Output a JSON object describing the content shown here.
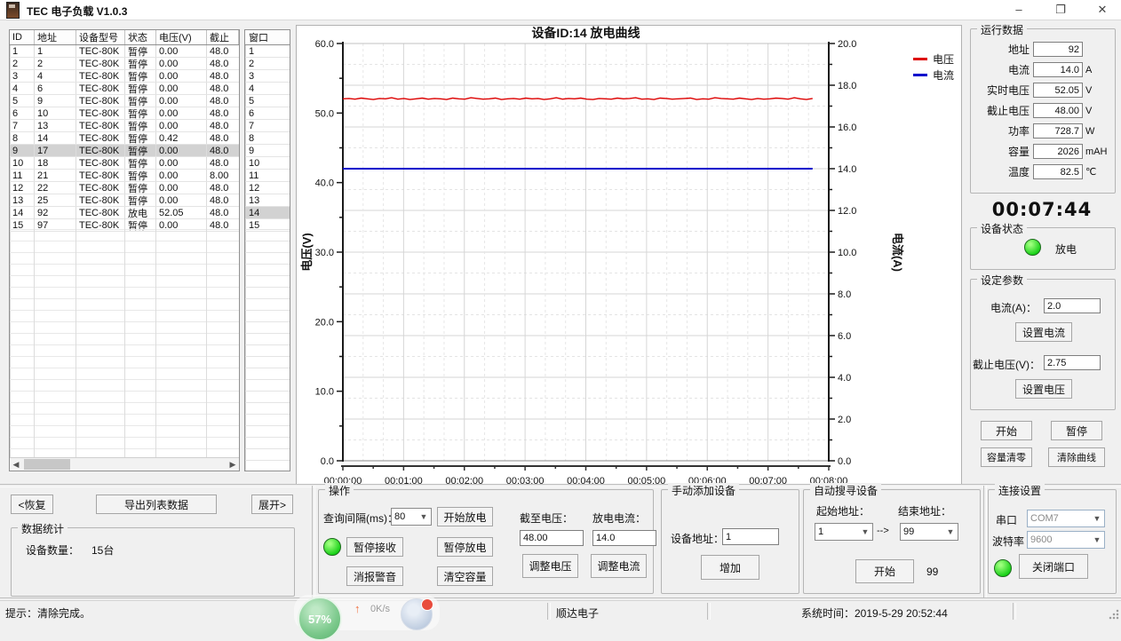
{
  "window": {
    "title": "TEC 电子负载 V1.0.3",
    "minimize": "–",
    "maximize": "❐",
    "close": "✕"
  },
  "left_table": {
    "headers": [
      "ID",
      "地址",
      "设备型号",
      "状态",
      "电压(V)",
      "截止"
    ],
    "selected_index": 8,
    "rows": [
      [
        "1",
        "1",
        "TEC-80K",
        "暂停",
        "0.00",
        "48.0"
      ],
      [
        "2",
        "2",
        "TEC-80K",
        "暂停",
        "0.00",
        "48.0"
      ],
      [
        "3",
        "4",
        "TEC-80K",
        "暂停",
        "0.00",
        "48.0"
      ],
      [
        "4",
        "6",
        "TEC-80K",
        "暂停",
        "0.00",
        "48.0"
      ],
      [
        "5",
        "9",
        "TEC-80K",
        "暂停",
        "0.00",
        "48.0"
      ],
      [
        "6",
        "10",
        "TEC-80K",
        "暂停",
        "0.00",
        "48.0"
      ],
      [
        "7",
        "13",
        "TEC-80K",
        "暂停",
        "0.00",
        "48.0"
      ],
      [
        "8",
        "14",
        "TEC-80K",
        "暂停",
        "0.42",
        "48.0"
      ],
      [
        "9",
        "17",
        "TEC-80K",
        "暂停",
        "0.00",
        "48.0"
      ],
      [
        "10",
        "18",
        "TEC-80K",
        "暂停",
        "0.00",
        "48.0"
      ],
      [
        "11",
        "21",
        "TEC-80K",
        "暂停",
        "0.00",
        "8.00"
      ],
      [
        "12",
        "22",
        "TEC-80K",
        "暂停",
        "0.00",
        "48.0"
      ],
      [
        "13",
        "25",
        "TEC-80K",
        "暂停",
        "0.00",
        "48.0"
      ],
      [
        "14",
        "92",
        "TEC-80K",
        "放电",
        "52.05",
        "48.0"
      ],
      [
        "15",
        "97",
        "TEC-80K",
        "暂停",
        "0.00",
        "48.0"
      ]
    ]
  },
  "window_table": {
    "header": "窗口",
    "selected_index": 13,
    "rows": [
      "1",
      "2",
      "3",
      "4",
      "5",
      "6",
      "7",
      "8",
      "9",
      "10",
      "11",
      "12",
      "13",
      "14",
      "15"
    ]
  },
  "chart": {
    "type": "line",
    "title": "设备ID:14 放电曲线",
    "legend": [
      {
        "name": "电压",
        "color": "#dd0000"
      },
      {
        "name": "电流",
        "color": "#0000cc"
      }
    ],
    "y_left": {
      "label": "电压(V)",
      "min": 0,
      "max": 60,
      "major_step": 10,
      "minor_step": 5
    },
    "y_right": {
      "label": "电流(A)",
      "min": 0,
      "max": 20,
      "major_step": 2,
      "minor_step": 1
    },
    "x": {
      "labels": [
        "00:00:00",
        "00:01:00",
        "00:02:00",
        "00:03:00",
        "00:04:00",
        "00:05:00",
        "00:06:00",
        "00:07:00",
        "00:08:00"
      ],
      "max_seconds": 480,
      "data_end_seconds": 464
    },
    "series": [
      {
        "name": "电压",
        "axis": "left",
        "color": "#dd0000",
        "values": [
          52.05,
          52.1,
          52.0,
          52.15,
          52.05,
          51.95,
          52.1,
          52.05,
          52.2,
          52.0,
          52.1,
          51.95,
          52.05,
          52.15,
          52.0,
          52.1,
          52.05,
          51.95,
          52.15,
          52.05,
          52.0,
          52.2,
          52.1,
          52.0,
          52.05,
          52.15,
          51.95,
          52.05,
          52.1,
          52.0,
          52.15,
          52.05,
          52.1,
          51.95,
          52.05,
          52.2,
          52.0,
          52.1,
          52.05,
          52.15,
          52.0,
          51.95,
          52.1,
          52.05,
          52.0,
          52.15,
          52.05,
          52.1,
          52.2,
          52.0,
          52.05,
          51.95,
          52.15,
          52.1,
          52.0,
          52.05,
          52.1,
          52.15,
          51.95,
          52.05,
          52.0,
          52.2,
          52.1,
          52.05,
          52.0,
          52.15,
          52.05,
          51.95,
          52.1,
          52.0,
          52.05,
          52.15,
          52.1,
          52.0,
          52.2,
          52.05,
          51.95,
          52.1
        ]
      },
      {
        "name": "电流",
        "axis": "right",
        "color": "#0000cc",
        "constant": 14.0
      }
    ]
  },
  "run_data": {
    "title": "运行数据",
    "fields": [
      {
        "label": "地址",
        "value": "92",
        "unit": ""
      },
      {
        "label": "电流",
        "value": "14.0",
        "unit": "A"
      },
      {
        "label": "实时电压",
        "value": "52.05",
        "unit": "V"
      },
      {
        "label": "截止电压",
        "value": "48.00",
        "unit": "V"
      },
      {
        "label": "功率",
        "value": "728.7",
        "unit": "W"
      },
      {
        "label": "容量",
        "value": "2026",
        "unit": "mAH"
      },
      {
        "label": "温度",
        "value": "82.5",
        "unit": "℃"
      }
    ]
  },
  "timer": "00:07:44",
  "device_status": {
    "title": "设备状态",
    "state": "放电"
  },
  "set_params": {
    "title": "设定参数",
    "current_label": "电流(A)：",
    "current_value": "2.0",
    "set_current_button": "设置电流",
    "cutoff_label": "截止电压(V)：",
    "cutoff_value": "2.75",
    "set_voltage_button": "设置电压"
  },
  "right_buttons": {
    "start": "开始",
    "pause": "暂停",
    "capacity_clear": "容量清零",
    "clear_curve": "清除曲线"
  },
  "bottom_left": {
    "restore_button": "<恢复",
    "export_button": "导出列表数据",
    "expand_button": "展开>",
    "stats_title": "数据统计",
    "device_count_label": "设备数量：",
    "device_count_value": "15台"
  },
  "operation": {
    "title": "操作",
    "interval_label": "查询间隔(ms)：",
    "interval_value": "80",
    "start_discharge": "开始放电",
    "pause_receive": "暂停接收",
    "pause_discharge": "暂停放电",
    "mute_alarm": "消报警音",
    "clear_capacity": "清空容量",
    "cutoff_label": "截至电压：",
    "cutoff_value": "48.00",
    "discharge_current_label": "放电电流：",
    "discharge_current_value": "14.0",
    "adjust_voltage": "调整电压",
    "adjust_current": "调整电流"
  },
  "manual_add": {
    "title": "手动添加设备",
    "addr_label": "设备地址：",
    "addr_value": "1",
    "add_button": "增加"
  },
  "auto_search": {
    "title": "自动搜寻设备",
    "start_label": "起始地址：",
    "start_value": "1",
    "arrow": "-->",
    "end_label": "结束地址：",
    "end_value": "99",
    "start_button": "开始",
    "progress": "99"
  },
  "connection": {
    "title": "连接设置",
    "serial_label": "串口",
    "serial_value": "COM7",
    "baud_label": "波特率",
    "baud_value": "9600",
    "close_port_button": "关闭端口"
  },
  "status_bar": {
    "hint": "提示：清除完成。",
    "company": "顺达电子",
    "system_time": "系统时间：2019-5-29 20:52:44"
  },
  "overlay_widget": {
    "percent": "57%",
    "up_arrow": "↑",
    "speed": "0K/s"
  },
  "colors": {
    "voltage_line": "#dd0000",
    "current_line": "#0000cc",
    "status_green": "#14cf14",
    "selection_gray": "#d2d2d2"
  }
}
